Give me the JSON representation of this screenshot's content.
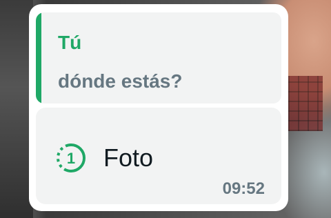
{
  "quoted_message": {
    "author": "Tú",
    "text": "dónde estás?"
  },
  "media_message": {
    "icon": "view-once-icon",
    "view_once_count": "1",
    "label": "Foto",
    "time": "09:52"
  },
  "colors": {
    "accent_green": "#1fa866",
    "secondary_text": "#667781",
    "primary_text": "#111b21",
    "bubble_bg": "#ffffff",
    "card_bg": "#f2f3f3"
  }
}
